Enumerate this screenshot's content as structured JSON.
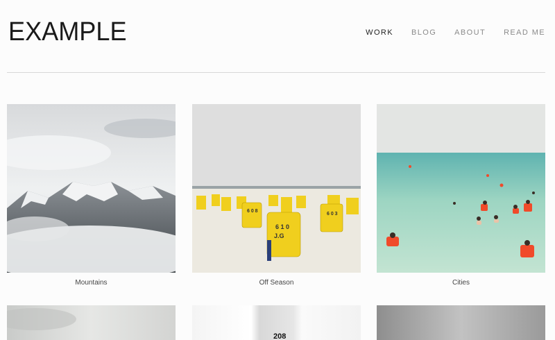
{
  "header": {
    "logo": "EXAMPLE",
    "nav": [
      {
        "label": "WORK",
        "active": true
      },
      {
        "label": "BLOG",
        "active": false
      },
      {
        "label": "ABOUT",
        "active": false
      },
      {
        "label": "READ ME",
        "active": false
      }
    ]
  },
  "gallery": {
    "items": [
      {
        "caption": "Mountains",
        "photo": "mountains-photo"
      },
      {
        "caption": "Off Season",
        "photo": "beach-chairs-photo"
      },
      {
        "caption": "Cities",
        "photo": "swimmers-sea-photo"
      }
    ],
    "partial_row": {
      "sign_text": "208"
    }
  },
  "colors": {
    "sand": "#ece9e0",
    "chair_yellow": "#f0cf1e",
    "sea": "#9dd5c2",
    "life_vest": "#f04a2a",
    "sky_grey": "#dcdcdc"
  }
}
